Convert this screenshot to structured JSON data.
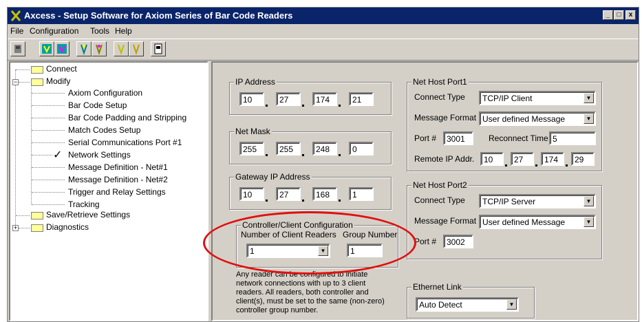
{
  "window": {
    "title": "Axcess - Setup Software for Axiom Series of Bar Code Readers",
    "minimize_glyph": "_",
    "maximize_glyph": "□",
    "close_glyph": "x"
  },
  "menu": {
    "file": "File",
    "configuration": "Configuration",
    "tools": "Tools",
    "help": "Help"
  },
  "tree": {
    "connect": "Connect",
    "modify": "Modify",
    "modify_children": [
      "Axiom Configuration",
      "Bar Code Setup",
      "Bar Code Padding and Stripping",
      "Match Codes Setup",
      "Serial Communications Port #1",
      "Network Settings",
      "Message Definition - Net#1",
      "Message Definition - Net#2",
      "Trigger and Relay Settings",
      "Tracking"
    ],
    "check_mark": "✓",
    "save_retrieve": "Save/Retrieve Settings",
    "diagnostics": "Diagnostics",
    "expand_minus": "−",
    "expand_plus": "+"
  },
  "ip_address": {
    "label": "IP Address",
    "octets": [
      "10",
      "27",
      "174",
      "21"
    ]
  },
  "net_mask": {
    "label": "Net Mask",
    "octets": [
      "255",
      "255",
      "248",
      "0"
    ]
  },
  "gateway": {
    "label": "Gateway IP Address",
    "octets": [
      "10",
      "27",
      "168",
      "1"
    ]
  },
  "controller": {
    "label": "Controller/Client Configuration",
    "num_readers_label": "Number of Client Readers",
    "num_readers_value": "1",
    "group_number_label": "Group Number",
    "group_number_value": "1",
    "note": "Any reader can be configured to initiate\nnetwork connections with up to 3 client\nreaders.  All readers, both controller and\nclient(s), must be set to the same (non-zero)\ncontroller group number."
  },
  "net_host_port1": {
    "label": "Net Host Port1",
    "connect_type_label": "Connect Type",
    "connect_type_value": "TCP/IP Client",
    "message_format_label": "Message Format",
    "message_format_value": "User defined Message",
    "port_label": "Port #",
    "port_value": "3001",
    "reconnect_label": "Reconnect Time",
    "reconnect_value": "5",
    "remote_ip_label": "Remote IP Addr.",
    "remote_ip_octets": [
      "10",
      "27",
      "174",
      "29"
    ]
  },
  "net_host_port2": {
    "label": "Net Host Port2",
    "connect_type_label": "Connect Type",
    "connect_type_value": "TCP/IP Server",
    "message_format_label": "Message Format",
    "message_format_value": "User defined Message",
    "port_label": "Port #",
    "port_value": "3002"
  },
  "ethernet_link": {
    "label": "Ethernet Link",
    "value": "Auto Detect"
  },
  "dropdown_glyph": "▼",
  "colors": {
    "titlebar": "#0a246a",
    "face": "#d4d0c8",
    "highlight_oval": "#e01010"
  }
}
